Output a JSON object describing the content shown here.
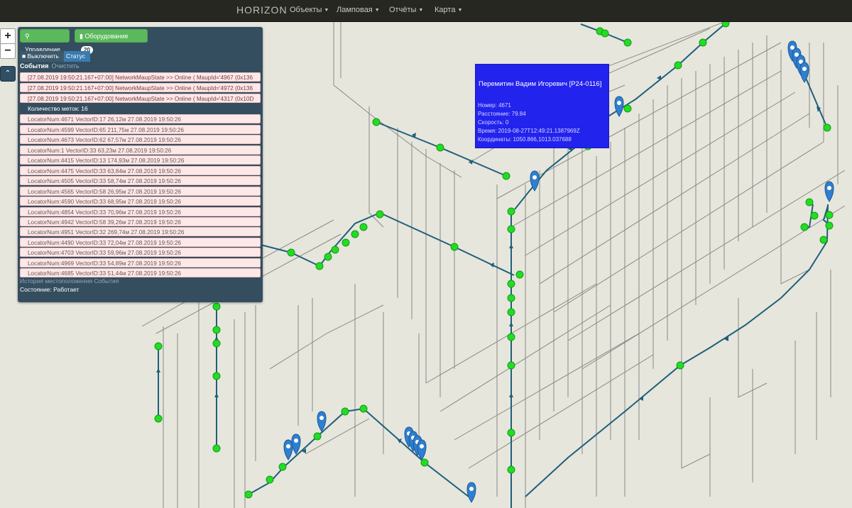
{
  "navbar": {
    "brand": "HORIZON",
    "items": [
      "Объекты",
      "Ламповая",
      "Отчёты",
      "Карта"
    ]
  },
  "zoom": {
    "in": "+",
    "out": "−",
    "collapse": "⌃"
  },
  "panel": {
    "control_label": "Управление",
    "equipment_label": "Оборудование",
    "equipment_count": "20",
    "disable_label": "Выключить",
    "status_label": "Статус",
    "events_title": "События",
    "clear_label": "Очистить",
    "log_rows": [
      "[27.08.2019 19:50:21.167+07:00] NetworkMaupState >> Online ( MaupId='4967 (0x136",
      "[27.08.2019 19:50:21.167+07:00] NetworkMaupState >> Online ( MaupId='4972 (0x136",
      "[27.08.2019 19:50:21.167+07:00] NetworkMaupState >> Online ( MaupId='4317 (0x10D"
    ],
    "count_label": "Количество меток: 16",
    "locator_rows": [
      "LocatorNum:4671 VectorID:17 26,12м 27.08.2019 19:50:26",
      "LocatorNum:4599 VectorID:65 211,75м 27.08.2019 19:50:26",
      "LocatorNum:4673 VectorID:62 67,57м 27.08.2019 19:50:26",
      "LocatorNum:1 VectorID:33 63,23м 27.08.2019 19:50:26",
      "LocatorNum:4415 VectorID:13 174,93м 27.08.2019 19:50:26",
      "LocatorNum:4475 VectorID:33 63,84м 27.08.2019 19:50:26",
      "LocatorNum:4505 VectorID:33 58,74м 27.08.2019 19:50:26",
      "LocatorNum:4565 VectorID:58 26,95м 27.08.2019 19:50:26",
      "LocatorNum:4590 VectorID:33 68,95м 27.08.2019 19:50:26",
      "LocatorNum:4854 VectorID:33 70,96м 27.08.2019 19:50:26",
      "LocatorNum:4942 VectorID:58 39,26м 27.08.2019 19:50:26",
      "LocatorNum:4951 VectorID:32 269,74м 27.08.2019 19:50:26",
      "LocatorNum:4490 VectorID:33 72,04м 27.08.2019 19:50:26",
      "LocatorNum:4703 VectorID:33 59,96м 27.08.2019 19:50:26",
      "LocatorNum:4969 VectorID:33 54,89м 27.08.2019 19:50:26",
      "LocatorNum:4685 VectorID:33 51,44м 27.08.2019 19:50:26"
    ],
    "history_link": "История местоположения События",
    "status_text": "Состояние: Работает"
  },
  "popup": {
    "title": "Перемитин Вадим Игоревич [Р24-0116]",
    "number": "Номер: 4671",
    "distance": "Расстояние: 79.84",
    "speed": "Скорость: 0",
    "time": "Время: 2019-08-27T12:49:21.1387969Z",
    "coords": "Координаты: 1050.866,1013.037688"
  },
  "colors": {
    "navbar": "#262721",
    "map_background": "#e6e6dd",
    "route": "#1f5f7a",
    "node": "#22dd22",
    "marker": "#2f7fd0",
    "popup": "#2323ee",
    "panel": "#344e5f"
  },
  "icons": [
    "zoom-in-icon",
    "zoom-out-icon",
    "collapse-icon",
    "search-icon",
    "bar-chart-icon",
    "stop-icon",
    "map-marker-icon",
    "caret-down-icon"
  ]
}
